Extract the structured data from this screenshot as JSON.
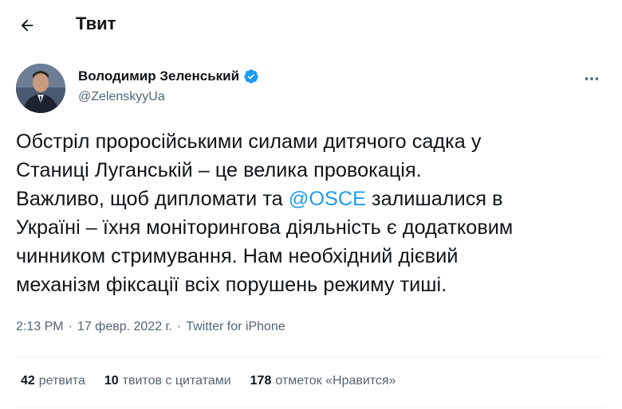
{
  "header": {
    "title": "Твит",
    "back_icon": "arrow-left-icon"
  },
  "tweet": {
    "display_name": "Володимир Зеленський",
    "handle": "@ZelenskyyUa",
    "verified_color": "#1d9bf0",
    "text_before_mention": "Обстріл проросійськими силами дитячого садка у\nСтаниці Луганській – це велика провокація.\nВажливо, щоб дипломати та ",
    "mention": "@OSCE",
    "text_after_mention": " залишалися в\nУкраїні – їхня моніторингова діяльність є додатковим\nчинником стримування. Нам необхідний дієвий\nмеханізм фіксації всіх порушень режиму тиші.",
    "time": "2:13 PM",
    "date": "17 февр. 2022 г.",
    "separator": "·",
    "source": "Twitter for iPhone"
  },
  "stats": {
    "retweets_count": "42",
    "retweets_label": "ретвита",
    "quotes_count": "10",
    "quotes_label": "твитов с цитатами",
    "likes_count": "178",
    "likes_label": "отметок «Нравится»"
  },
  "colors": {
    "accent": "#1d9bf0",
    "secondary_text": "#536471",
    "primary_text": "#0f1419"
  }
}
